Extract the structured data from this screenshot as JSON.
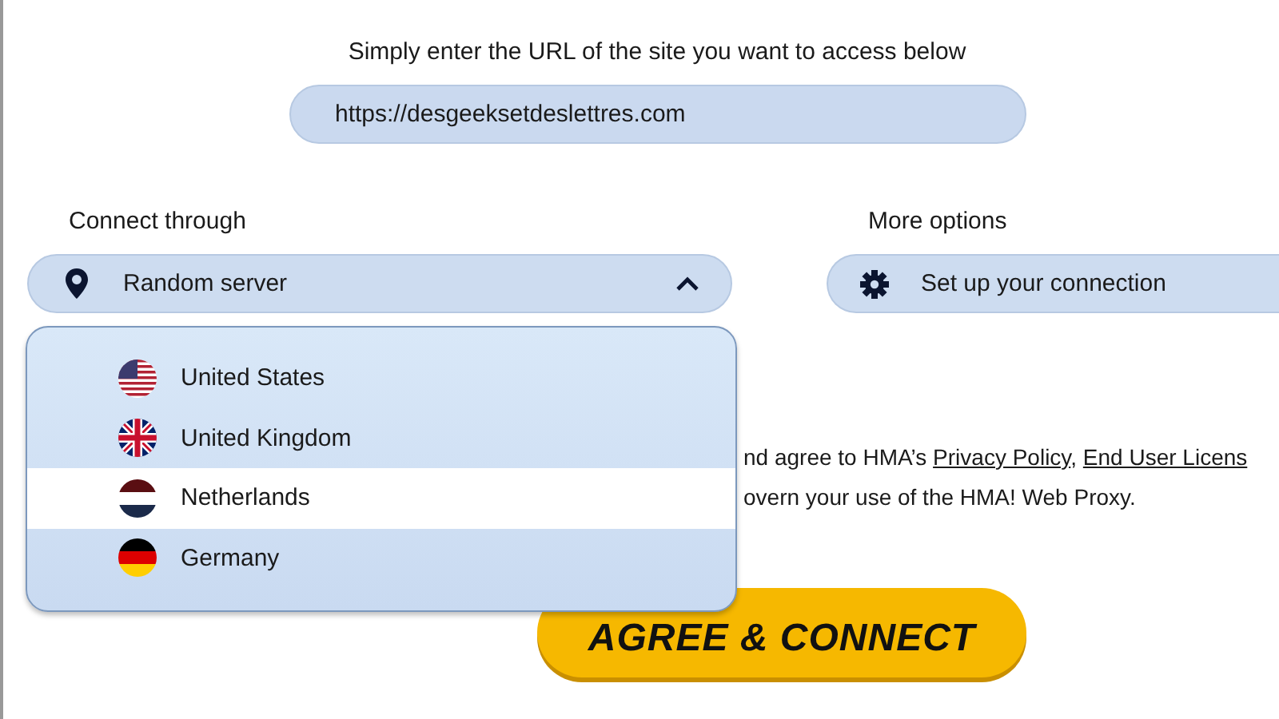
{
  "url_prompt": "Simply enter the URL of the site you want to access below",
  "url_field": {
    "value": "https://desgeeksetdeslettres.com"
  },
  "connect": {
    "label": "Connect through",
    "value": "Random server",
    "expanded": true,
    "options": [
      {
        "label": "United States",
        "kind": "us",
        "selected": false
      },
      {
        "label": "United Kingdom",
        "kind": "gb",
        "selected": false
      },
      {
        "label": "Netherlands",
        "kind": "nl",
        "selected": true
      },
      {
        "label": "Germany",
        "kind": "de",
        "selected": false
      }
    ]
  },
  "more_options": {
    "label": "More options",
    "button": "Set up your connection"
  },
  "terms": {
    "line_1": "nd agree to HMA’s ",
    "link_1": "Privacy Policy",
    "separator": ",",
    "link_2": "End User Licens",
    "line_2": "overn your use of the HMA! Web Proxy."
  },
  "agree_button": "AGREE & CONNECT"
}
